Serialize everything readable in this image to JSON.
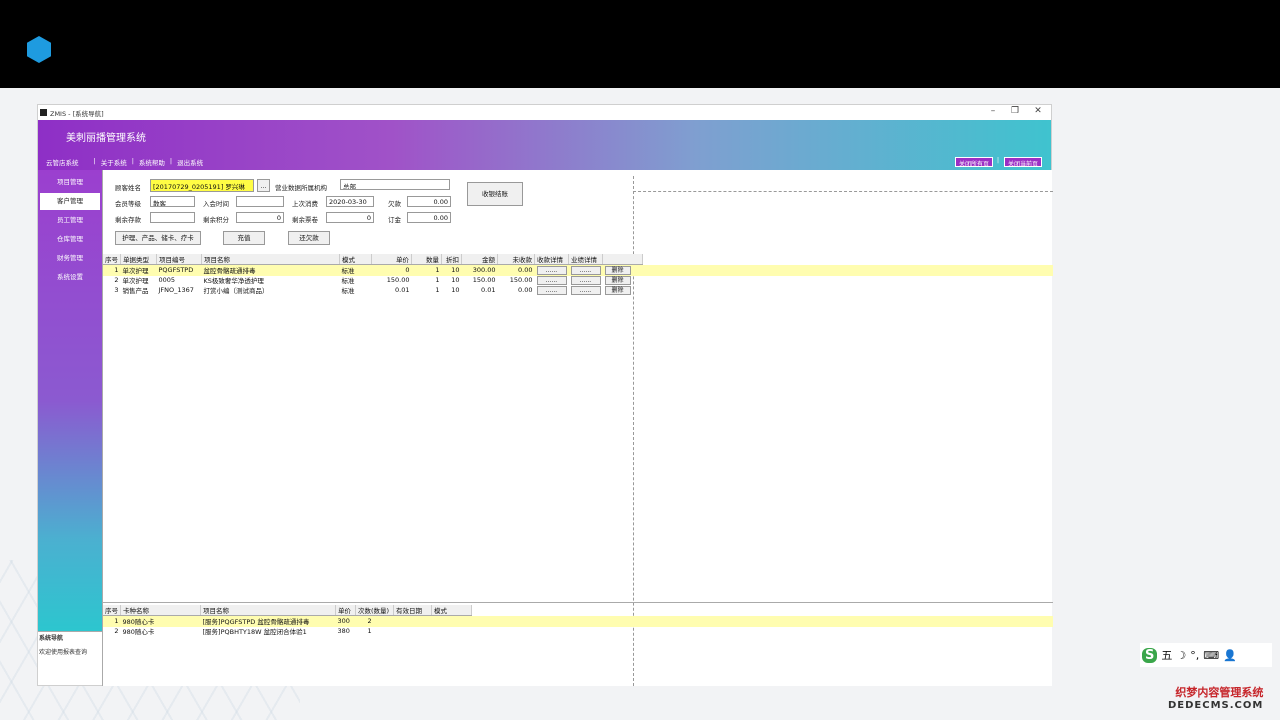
{
  "window": {
    "title": "ZMIS - [系统导航]",
    "app_title": "美刺丽播管理系统"
  },
  "menu": {
    "items": [
      "云管店系统",
      "|",
      "关于系统",
      "|",
      "系统帮助",
      "|",
      "退出系统"
    ]
  },
  "close_buttons": {
    "all": "关闭所有页",
    "sep": "|",
    "current": "关闭当前页"
  },
  "sidebar": {
    "items": [
      "项目管理",
      "客户管理",
      "员工管理",
      "仓库管理",
      "财务管理",
      "系统设置"
    ],
    "active": 1,
    "footer_title": "系统导航",
    "footer_text": "欢迎使用报表查询"
  },
  "form": {
    "customer_label": "顾客姓名",
    "customer_value": "[20170729_0205191] 罗兴琳",
    "browse_label": "...",
    "org_label": "营业数据所属机构",
    "org_value": "总部",
    "member_level_label": "会员等级",
    "member_level_value": "散客",
    "join_time_label": "入会时间",
    "join_time_value": "",
    "last_spend_label": "上次消费",
    "last_spend_value": "2020-03-30",
    "debt_label": "欠款",
    "debt_value": "0.00",
    "remain_deposit_label": "剩余存款",
    "remain_deposit_value": "",
    "remain_points_label": "剩余积分",
    "remain_points_value": "0",
    "remain_coupon_label": "剩余票卷",
    "remain_coupon_value": "0",
    "order_label": "订金",
    "order_value": "0.00",
    "checkout_button": "收银结账",
    "care_button": "护理、产品、储卡、疗卡",
    "recharge_button": "充值",
    "repay_button": "还欠款"
  },
  "orders": {
    "headers": [
      "序号",
      "单据类型",
      "项目编号",
      "项目名称",
      "模式",
      "单价",
      "数量",
      "折扣",
      "金额",
      "未收款",
      "收款详情",
      "业绩详情",
      ""
    ],
    "rows": [
      {
        "no": "1",
        "type": "单次护理",
        "code": "PQGFSTPD",
        "name": "盆腔骨骼疏通排毒",
        "mode": "标准",
        "price": "0",
        "qty": "1",
        "discount": "10",
        "amount": "300.00",
        "unpaid": "0.00",
        "pay": "......",
        "perf": "......",
        "del": "删除"
      },
      {
        "no": "2",
        "type": "单次护理",
        "code": "0005",
        "name": "KS极致奢华净透护理",
        "mode": "标准",
        "price": "150.00",
        "qty": "1",
        "discount": "10",
        "amount": "150.00",
        "unpaid": "150.00",
        "pay": "......",
        "perf": "......",
        "del": "删除"
      },
      {
        "no": "3",
        "type": "销售产品",
        "code": "JFNO_1367",
        "name": "打赏小编（测试商品）",
        "mode": "标准",
        "price": "0.01",
        "qty": "1",
        "discount": "10",
        "amount": "0.01",
        "unpaid": "0.00",
        "pay": "......",
        "perf": "......",
        "del": "删除"
      }
    ]
  },
  "cards": {
    "headers": [
      "序号",
      "卡种名称",
      "项目名称",
      "单价",
      "次数(数量)",
      "有效日期",
      "模式"
    ],
    "rows": [
      {
        "no": "1",
        "card": "980随心卡",
        "name": "[服务]PQGFSTPD 盆腔骨骼疏通排毒",
        "price": "300",
        "count": "2",
        "date": "",
        "mode": ""
      },
      {
        "no": "2",
        "card": "980随心卡",
        "name": "[服务]PQBHTY18W 盆腔闭合体验1",
        "price": "380",
        "count": "1",
        "date": "",
        "mode": ""
      }
    ]
  },
  "ime": {
    "logo": "S",
    "items": [
      "五",
      "☽",
      "°,",
      "⌨",
      "👤"
    ]
  },
  "watermark": {
    "line1": "织梦内容管理系统",
    "line2": "DEDECMS.COM"
  }
}
